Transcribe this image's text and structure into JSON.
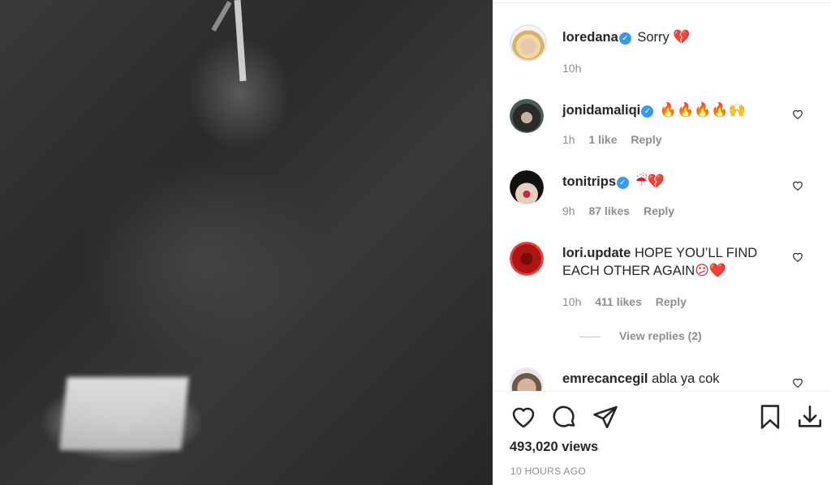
{
  "post": {
    "views": "493,020 views",
    "time_ago": "10 HOURS AGO"
  },
  "caption": {
    "username": "loredana",
    "text": "Sorry",
    "emoji": "💔",
    "time": "10h"
  },
  "comments": [
    {
      "username": "jonidamaliqi",
      "verified": true,
      "text": "",
      "emoji": "🔥🔥🔥🔥🙌",
      "time": "1h",
      "likes": "1 like",
      "reply": "Reply"
    },
    {
      "username": "tonitrips",
      "verified": true,
      "text": "",
      "emoji": "☔💔",
      "time": "9h",
      "likes": "87 likes",
      "reply": "Reply"
    },
    {
      "username": "lori.update",
      "verified": false,
      "text": "HOPE YOU’LL FIND EACH OTHER AGAIN",
      "emoji": "😕❤️",
      "time": "10h",
      "likes": "411 likes",
      "reply": "Reply",
      "view_replies": "View replies (2)"
    },
    {
      "username": "emrecancegil",
      "verified": false,
      "text": "abla ya cok",
      "emoji": ""
    }
  ],
  "icons": {
    "like": "heart-outline-icon",
    "comment": "comment-bubble-icon",
    "share": "paper-plane-icon",
    "save": "bookmark-icon",
    "download": "download-icon",
    "verified": "verified-badge-icon"
  },
  "colors": {
    "verified": "#3897f0",
    "muted": "#8e8e8e",
    "text": "#262626"
  }
}
